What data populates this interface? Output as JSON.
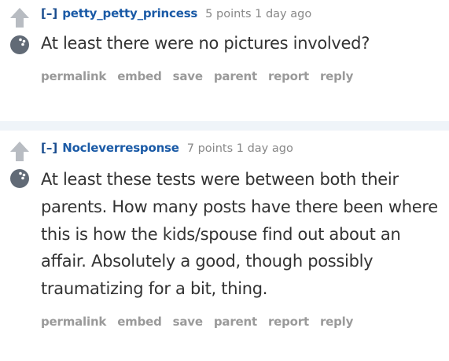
{
  "colors": {
    "upvote_arrow": "#b8bcc2",
    "avatar": "#616a76",
    "divider": "#eff4f9",
    "author": "#1a5aa6",
    "meta": "#888888",
    "body": "#333333",
    "buttons": "#9a9a9a"
  },
  "comments": [
    {
      "collapse": "[–]",
      "author": "petty_petty_princess",
      "score_time": "5 points 1 day ago",
      "body": "At least there were no pictures involved?",
      "icons": [
        "upvote-arrow-icon",
        "bowling-ball-avatar-icon"
      ],
      "buttons": [
        "permalink",
        "embed",
        "save",
        "parent",
        "report",
        "reply"
      ]
    },
    {
      "collapse": "[–]",
      "author": "Nocleverresponse",
      "score_time": "7 points 1 day ago",
      "body": "At least these tests were between both their parents. How many posts have there been where this is how the kids/spouse find out about an affair. Absolutely a good, though possibly traumatizing for a bit, thing.",
      "icons": [
        "upvote-arrow-icon",
        "bowling-ball-avatar-icon"
      ],
      "buttons": [
        "permalink",
        "embed",
        "save",
        "parent",
        "report",
        "reply"
      ]
    }
  ]
}
